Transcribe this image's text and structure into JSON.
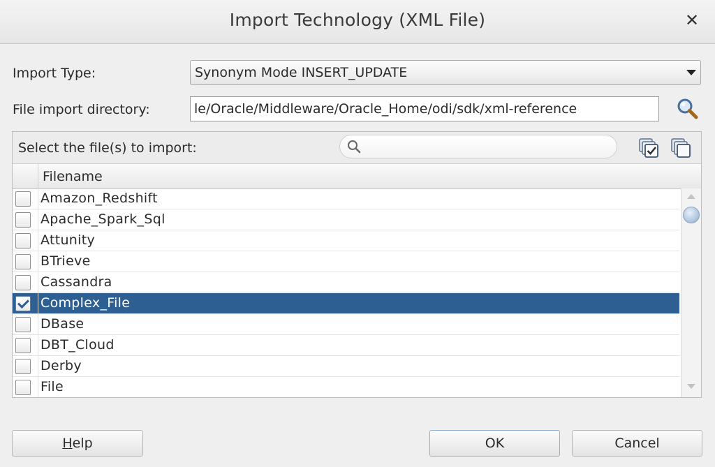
{
  "dialog": {
    "title": "Import Technology (XML File)",
    "close_icon": "close-icon"
  },
  "form": {
    "import_type_label": "Import Type:",
    "import_type_value": "Synonym Mode INSERT_UPDATE",
    "directory_label": "File import directory:",
    "directory_value": "le/Oracle/Middleware/Oracle_Home/odi/sdk/xml-reference"
  },
  "files": {
    "label": "Select the file(s) to import:",
    "search_placeholder": "",
    "column_header": "Filename",
    "rows": [
      {
        "name": "Amazon_Redshift",
        "checked": false,
        "selected": false
      },
      {
        "name": "Apache_Spark_Sql",
        "checked": false,
        "selected": false
      },
      {
        "name": "Attunity",
        "checked": false,
        "selected": false
      },
      {
        "name": "BTrieve",
        "checked": false,
        "selected": false
      },
      {
        "name": "Cassandra",
        "checked": false,
        "selected": false
      },
      {
        "name": "Complex_File",
        "checked": true,
        "selected": true
      },
      {
        "name": "DBase",
        "checked": false,
        "selected": false
      },
      {
        "name": "DBT_Cloud",
        "checked": false,
        "selected": false
      },
      {
        "name": "Derby",
        "checked": false,
        "selected": false
      },
      {
        "name": "File",
        "checked": false,
        "selected": false
      }
    ]
  },
  "buttons": {
    "help_mnemonic": "H",
    "help_rest": "elp",
    "ok": "OK",
    "cancel": "Cancel"
  },
  "colors": {
    "selection": "#2e5f92",
    "check": "#2c5c93"
  }
}
